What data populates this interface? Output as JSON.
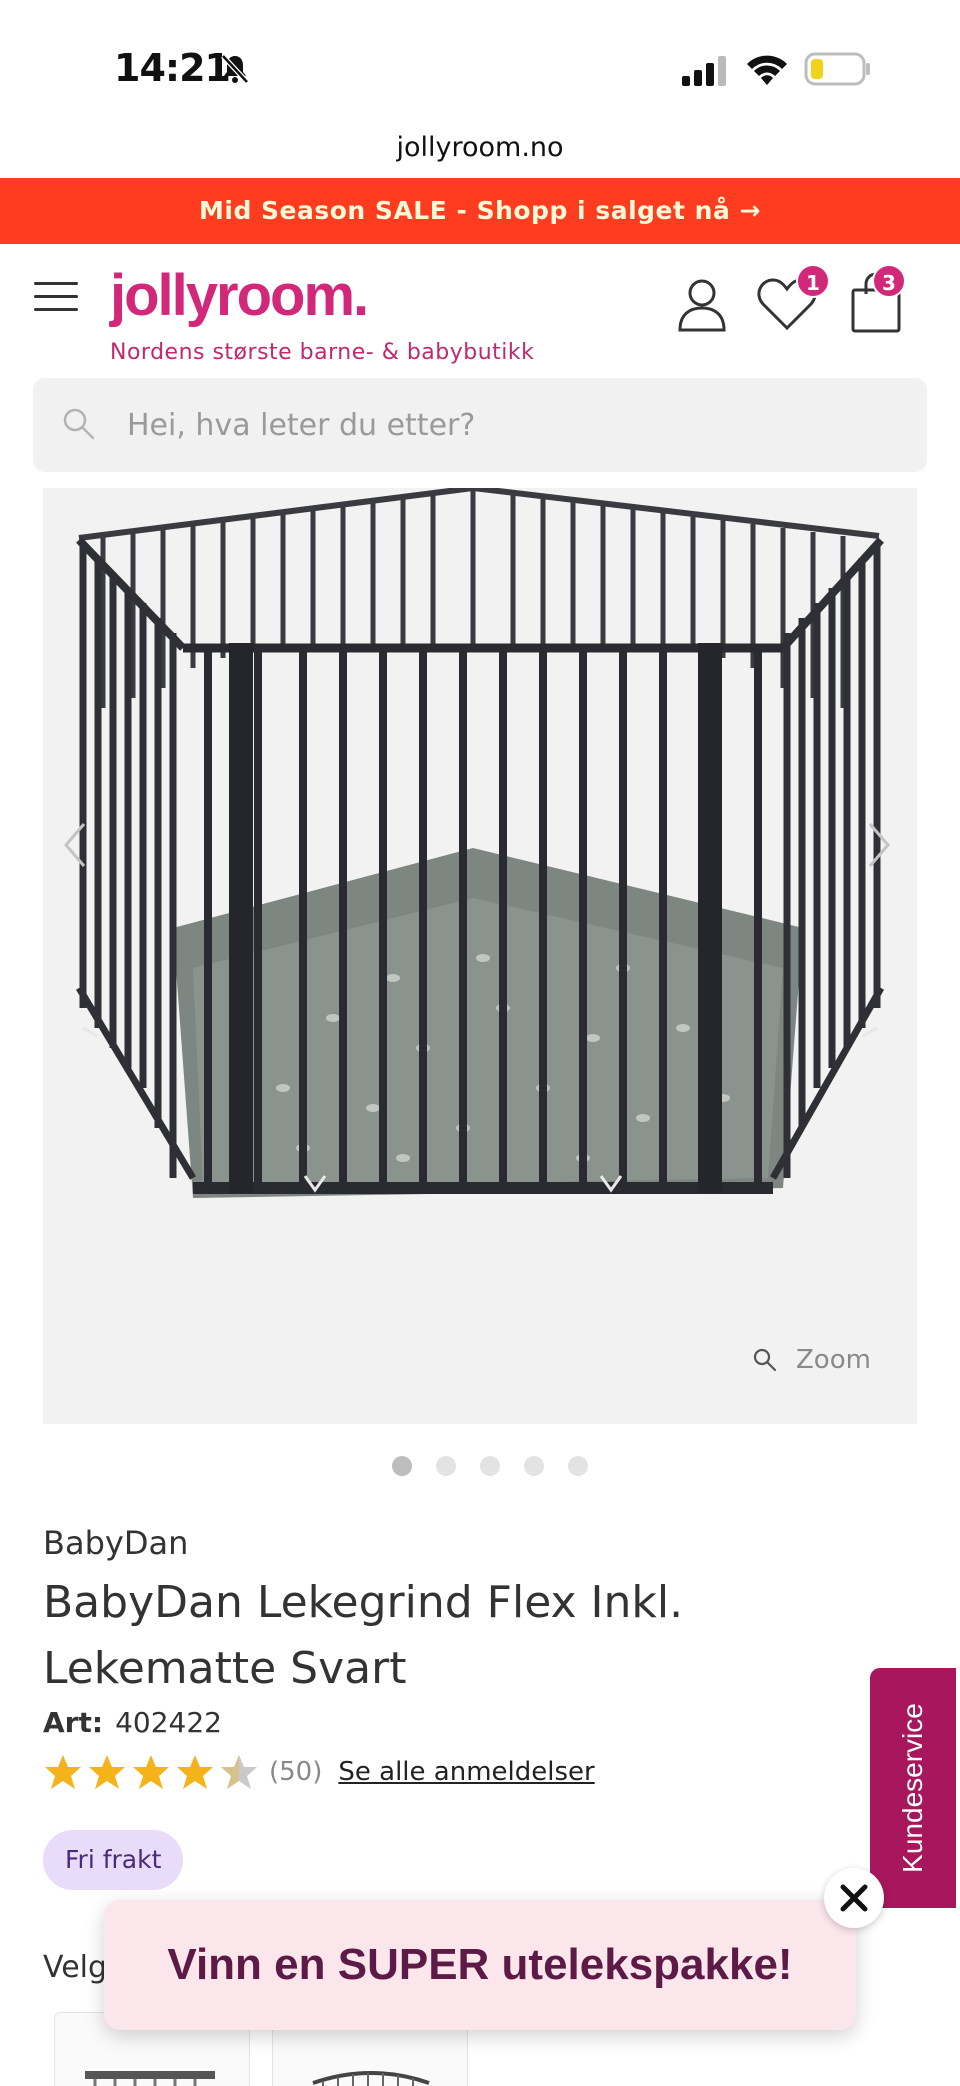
{
  "status_bar": {
    "time": "14:21"
  },
  "browser": {
    "url": "jollyroom.no"
  },
  "promo": {
    "text": "Mid Season SALE - Shopp i salget nå →"
  },
  "header": {
    "logo": "jollyroom.",
    "tagline": "Nordens største barne- & babybutikk",
    "wishlist_count": "1",
    "cart_count": "3",
    "brand_color": "#d1287a"
  },
  "search": {
    "placeholder": "Hei, hva leter du etter?",
    "value": ""
  },
  "gallery": {
    "zoom_label": "Zoom",
    "slide_count": 5,
    "active_slide": 1
  },
  "product": {
    "brand": "BabyDan",
    "title": "BabyDan Lekegrind Flex Inkl. Lekematte Svart",
    "art_label": "Art:",
    "art_number": "402422",
    "rating": 4,
    "rating_count": "(50)",
    "reviews_link": "Se alle anmeldelser",
    "shipping_badge": "Fri frakt",
    "variant_label": "Velg"
  },
  "side_tab": {
    "label": "Kundeservice"
  },
  "popup": {
    "text": "Vinn en SUPER utelekspakke!"
  },
  "colors": {
    "promo_bg": "#ff3c1f",
    "side_tab_bg": "#a8175e",
    "popup_bg": "#fbe6ec",
    "star": "#f5b31b"
  }
}
